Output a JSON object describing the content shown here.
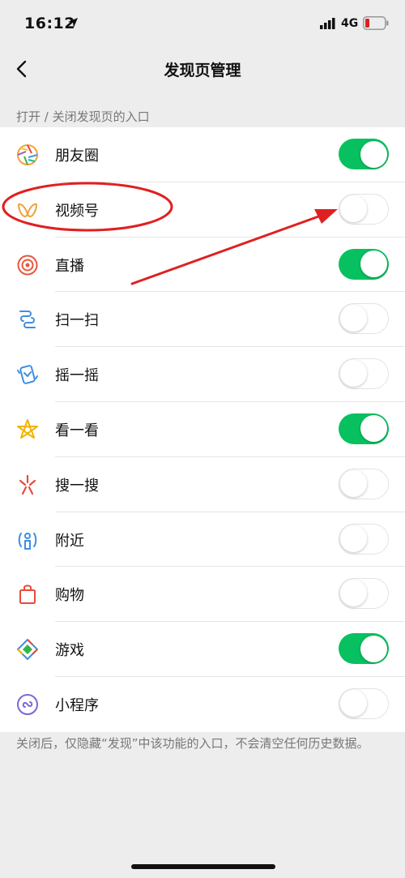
{
  "status_bar": {
    "time": "16:12",
    "network": "4G",
    "icons": [
      "location-arrow-icon",
      "signal-icon",
      "battery-low-icon"
    ]
  },
  "nav": {
    "title": "发现页管理",
    "back_icon": "chevron-left-icon"
  },
  "section_header": "打开 / 关闭发现页的入口",
  "items": [
    {
      "label": "朋友圈",
      "icon": "moments-aperture-icon",
      "on": true
    },
    {
      "label": "视频号",
      "icon": "channels-butterfly-icon",
      "on": false
    },
    {
      "label": "直播",
      "icon": "live-target-icon",
      "on": true
    },
    {
      "label": "扫一扫",
      "icon": "scan-icon",
      "on": false
    },
    {
      "label": "摇一摇",
      "icon": "shake-phone-icon",
      "on": false
    },
    {
      "label": "看一看",
      "icon": "top-stories-star-icon",
      "on": true
    },
    {
      "label": "搜一搜",
      "icon": "search-spark-icon",
      "on": false
    },
    {
      "label": "附近",
      "icon": "people-nearby-icon",
      "on": false
    },
    {
      "label": "购物",
      "icon": "shopping-bag-icon",
      "on": false
    },
    {
      "label": "游戏",
      "icon": "games-diamond-icon",
      "on": true
    },
    {
      "label": "小程序",
      "icon": "mini-programs-icon",
      "on": false
    }
  ],
  "footer_note": "关闭后，仅隐藏“发现”中该功能的入口，不会清空任何历史数据。",
  "colors": {
    "toggle_on": "#07c160",
    "annotation_red": "#e02020",
    "background": "#ededed"
  }
}
